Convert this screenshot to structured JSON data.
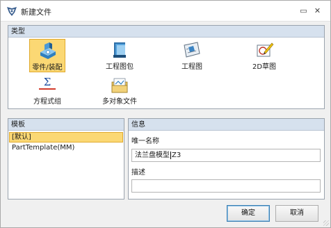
{
  "window": {
    "title": "新建文件",
    "restore_glyph": "▭",
    "close_glyph": "✕"
  },
  "type_section": {
    "header": "类型",
    "items": [
      {
        "label": "零件/装配",
        "icon": "part-assembly-icon",
        "selected": true
      },
      {
        "label": "工程图包",
        "icon": "drawing-package-icon",
        "selected": false
      },
      {
        "label": "工程图",
        "icon": "drawing-icon",
        "selected": false
      },
      {
        "label": "2D草图",
        "icon": "2d-sketch-icon",
        "selected": false
      },
      {
        "label": "方程式组",
        "icon": "equation-set-icon",
        "selected": false
      },
      {
        "label": "多对象文件",
        "icon": "multi-object-file-icon",
        "selected": false
      }
    ],
    "equation_glyph": "Σ"
  },
  "template_section": {
    "header": "模板",
    "items": [
      {
        "label": "[默认]",
        "selected": true
      },
      {
        "label": "PartTemplate(MM)",
        "selected": false
      }
    ]
  },
  "info_section": {
    "header": "信息",
    "unique_name_label": "唯一名称",
    "unique_name_value": "法兰盘模型",
    "unique_name_suffix": "Z3",
    "description_label": "描述",
    "description_value": ""
  },
  "buttons": {
    "ok": "确定",
    "cancel": "取消"
  },
  "colors": {
    "selection": "#fbd874",
    "header_bg": "#d6e1ee",
    "accent": "#3c7fb1"
  }
}
